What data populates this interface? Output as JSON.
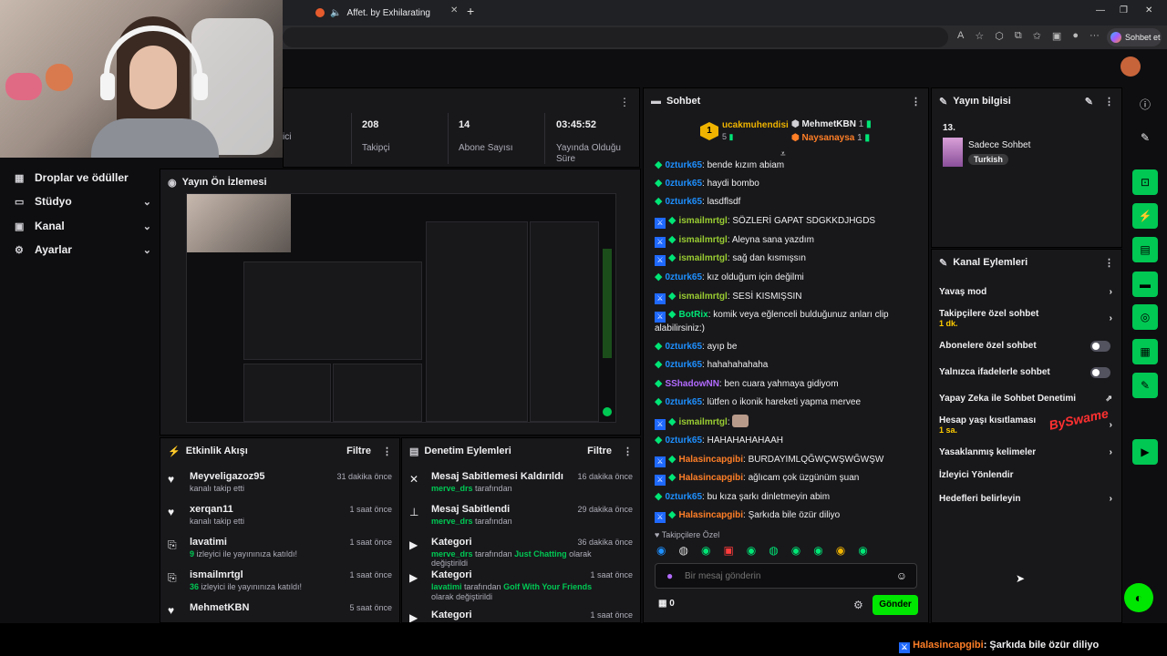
{
  "browser": {
    "tab_title": "Affet. by ExhilaratingMegaphone",
    "new_tab": "+",
    "copilot": "Sohbet et",
    "window_controls": [
      "—",
      "❐",
      "✕"
    ]
  },
  "nav": {
    "items": [
      {
        "label": "Droplar ve ödüller",
        "icon": "gift-icon"
      },
      {
        "label": "Stüdyo",
        "icon": "studio-icon"
      },
      {
        "label": "Kanal",
        "icon": "channel-icon"
      },
      {
        "label": "Ayarlar",
        "icon": "settings-icon"
      }
    ]
  },
  "stats": {
    "viewers_label": "ici",
    "followers": {
      "value": "208",
      "label": "Takipçi"
    },
    "subs": {
      "value": "14",
      "label": "Abone Sayısı"
    },
    "live": {
      "value": "03:45:52",
      "label": "Yayında Olduğu Süre"
    }
  },
  "preview": {
    "title": "Yayın Ön İzlemesi"
  },
  "activity": {
    "title": "Etkinlik Akışı",
    "filter": "Filtre",
    "items": [
      {
        "name": "Meyveligazoz95",
        "sub": "kanalı takip etti",
        "time": "31 dakika önce",
        "icon": "heart-icon"
      },
      {
        "name": "xerqan11",
        "sub": "kanalı takip etti",
        "time": "1 saat önce",
        "icon": "heart-icon"
      },
      {
        "name": "lavatimi",
        "hl": "9",
        "sub": " izleyici ile yayınınıza katıldı!",
        "time": "1 saat önce",
        "icon": "raid-icon"
      },
      {
        "name": "ismailmrtgl",
        "hl": "36",
        "sub": " izleyici ile yayınınıza katıldı!",
        "time": "1 saat önce",
        "icon": "raid-icon"
      },
      {
        "name": "MehmetKBN",
        "sub": "",
        "time": "5 saat önce",
        "icon": "heart-icon"
      }
    ]
  },
  "moderation": {
    "title": "Denetim Eylemleri",
    "filter": "Filtre",
    "items": [
      {
        "title": "Mesaj Sabitlemesi Kaldırıldı",
        "user": "merve_drs",
        "rest": " tarafından",
        "time": "16 dakika önce",
        "icon": "unpin-icon"
      },
      {
        "title": "Mesaj Sabitlendi",
        "user": "merve_drs",
        "rest": " tarafından",
        "time": "29 dakika önce",
        "icon": "pin-icon"
      },
      {
        "title": "Kategori",
        "user": "merve_drs",
        "rest": " tarafından ",
        "cat": "Just Chatting",
        "tail": " olarak değiştirildi",
        "time": "36 dakika önce",
        "icon": "category-icon"
      },
      {
        "title": "Kategori",
        "user": "lavatimi",
        "rest": " tarafından ",
        "cat": "Golf With Your Friends",
        "tail": " olarak değiştirildi",
        "time": "1 saat önce",
        "icon": "category-icon"
      },
      {
        "title": "Kategori",
        "user": "",
        "rest": "",
        "time": "1 saat önce",
        "icon": "category-icon"
      }
    ]
  },
  "chat": {
    "title": "Sohbet",
    "leaderboard": {
      "first": {
        "name": "ucakmuhendisi",
        "count": "5",
        "rank": "1"
      },
      "others": [
        {
          "name": "MehmetKBN",
          "count": "1"
        },
        {
          "name": "Naysanaysa",
          "count": "1"
        }
      ]
    },
    "messages": [
      {
        "user": "0zturk65",
        "text": "bende kızım abiam",
        "color": "#1e90ff",
        "mod": false
      },
      {
        "user": "0zturk65",
        "text": "haydi bombo",
        "color": "#1e90ff",
        "mod": false
      },
      {
        "user": "0zturk65",
        "text": "lasdflsdf",
        "color": "#1e90ff",
        "mod": false
      },
      {
        "user": "ismailmrtgl",
        "text": "SÖZLERİ GAPAT SDGKKDJHGDS",
        "color": "#9acd32",
        "mod": true
      },
      {
        "user": "ismailmrtgl",
        "text": "Aleyna sana yazdım",
        "color": "#9acd32",
        "mod": true
      },
      {
        "user": "ismailmrtgl",
        "text": "sağ dan kısmışsın",
        "color": "#9acd32",
        "mod": true
      },
      {
        "user": "0zturk65",
        "text": "kız olduğum için değilmi",
        "color": "#1e90ff",
        "mod": false
      },
      {
        "user": "ismailmrtgl",
        "text": "SESİ KISMIŞSIN",
        "color": "#9acd32",
        "mod": true
      },
      {
        "user": "BotRix",
        "text": "komik veya eğlenceli bulduğunuz anları clip alabilirsiniz:)",
        "color": "#00e676",
        "mod": true
      },
      {
        "user": "0zturk65",
        "text": "ayıp be",
        "color": "#1e90ff",
        "mod": false
      },
      {
        "user": "0zturk65",
        "text": "hahahahahaha",
        "color": "#1e90ff",
        "mod": false
      },
      {
        "user": "SShadowNN",
        "text": "ben cuara yahmaya gidiyom",
        "color": "#b36bff",
        "mod": false
      },
      {
        "user": "0zturk65",
        "text": "lütfen o ikonik hareketi yapma mervee",
        "color": "#1e90ff",
        "mod": false
      },
      {
        "user": "ismailmrtgl",
        "text": "",
        "color": "#9acd32",
        "mod": true,
        "emote": true
      },
      {
        "user": "0zturk65",
        "text": "HAHAHAHAHAAH",
        "color": "#1e90ff",
        "mod": false
      },
      {
        "user": "Halasincapgibi",
        "text": "BURDAYIMLQĞWÇWŞWĞWŞW",
        "color": "#ff7f27",
        "mod": true
      },
      {
        "user": "Halasincapgibi",
        "text": "ağlıcam çok üzgünüm şuan",
        "color": "#ff7f27",
        "mod": true
      },
      {
        "user": "0zturk65",
        "text": "bu kıza şarkı dinletmeyin abim",
        "color": "#1e90ff",
        "mod": false
      },
      {
        "user": "Halasincapgibi",
        "text": "Şarkıda bile özür diliyo",
        "color": "#ff7f27",
        "mod": true
      }
    ],
    "followers_only": "Takipçilere Özel",
    "placeholder": "Bir mesaj gönderin",
    "points": "0",
    "send": "Gönder"
  },
  "stream_info": {
    "title": "Yayın bilgisi",
    "number": "13.",
    "category": "Sadece Sohbet",
    "tag": "Turkish"
  },
  "channel_actions": {
    "title": "Kanal Eylemleri",
    "items": [
      {
        "label": "Yavaş mod",
        "type": "arrow"
      },
      {
        "label": "Takipçilere özel sohbet",
        "sub": "1 dk.",
        "type": "arrow"
      },
      {
        "label": "Abonelere özel sohbet",
        "type": "toggle"
      },
      {
        "label": "Yalnızca ifadelerle sohbet",
        "type": "toggle"
      },
      {
        "label": "Yapay Zeka ile Sohbet Denetimi",
        "type": "external"
      },
      {
        "label": "Hesap yaşı kısıtlaması",
        "sub": "1 sa.",
        "type": "arrow"
      },
      {
        "label": "Yasaklanmış kelimeler",
        "type": "arrow"
      },
      {
        "label": "İzleyici Yönlendir",
        "type": "none"
      },
      {
        "label": "Hedefleri belirleyin",
        "type": "arrow"
      }
    ]
  },
  "watermark": "BySwame",
  "ticker": {
    "user": "Halasincapgibi",
    "text": ": Şarkıda bile özür diliyo"
  },
  "colors": {
    "accent": "#00e701",
    "mod_badge": "#1f69ff",
    "panel": "#18181b"
  }
}
